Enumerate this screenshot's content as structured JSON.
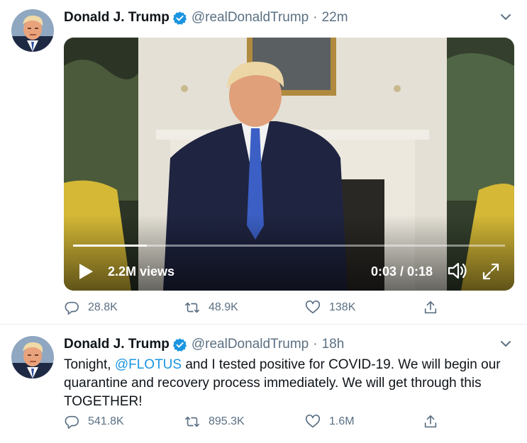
{
  "colors": {
    "accent": "#1b95e0",
    "muted": "#5b7083",
    "text": "#0f1419"
  },
  "tweets": [
    {
      "author": {
        "name": "Donald J. Trump",
        "handle": "@realDonaldTrump",
        "verified": true,
        "avatar": "avatar"
      },
      "time": "22m",
      "separator": "·",
      "media": {
        "type": "video",
        "views": "2.2M views",
        "timecode": "0:03 / 0:18",
        "progress": 0.17,
        "icons": [
          "play-icon",
          "volume-icon",
          "fullscreen-icon"
        ]
      },
      "stats": {
        "replies": "28.8K",
        "retweets": "48.9K",
        "likes": "138K"
      }
    },
    {
      "author": {
        "name": "Donald J. Trump",
        "handle": "@realDonaldTrump",
        "verified": true,
        "avatar": "avatar"
      },
      "time": "18h",
      "separator": "·",
      "text": {
        "before": "Tonight, ",
        "mention": "@FLOTUS",
        "after": " and I tested positive for COVID-19. We will begin our quarantine and recovery process immediately. We will get through this TOGETHER!"
      },
      "stats": {
        "replies": "541.8K",
        "retweets": "895.3K",
        "likes": "1.6M"
      }
    }
  ]
}
